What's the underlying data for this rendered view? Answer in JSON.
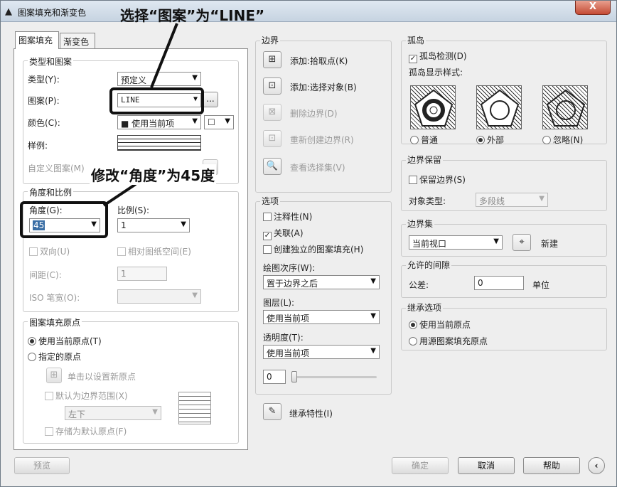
{
  "window": {
    "title": "图案填充和渐变色",
    "close_label": "X"
  },
  "annotations": {
    "top": "选择“图案”为“LINE”",
    "middle": "修改“角度”为45度"
  },
  "tabs": [
    {
      "label": "图案填充"
    },
    {
      "label": "渐变色"
    }
  ],
  "type_pattern": {
    "group_label": "类型和图案",
    "type_label": "类型(Y):",
    "type_value": "预定义",
    "pattern_label": "图案(P):",
    "pattern_value": "LINE",
    "pattern_browse": "...",
    "color_label": "颜色(C):",
    "color_value": "■ 使用当前项",
    "color_bg_value": "☐",
    "sample_label": "样例:",
    "custom_label": "自定义图案(M)"
  },
  "angle_scale": {
    "group_label": "角度和比例",
    "angle_label": "角度(G):",
    "angle_value": "45",
    "scale_label": "比例(S):",
    "scale_value": "1",
    "double_label": "双向(U)",
    "relative_label": "相对图纸空间(E)",
    "spacing_label": "间距(C):",
    "spacing_value": "1",
    "iso_label": "ISO 笔宽(O):"
  },
  "origin": {
    "group_label": "图案填充原点",
    "use_current": "使用当前原点(T)",
    "specified": "指定的原点",
    "click_set": "单击以设置新原点",
    "default_extent": "默认为边界范围(X)",
    "extent_value": "左下",
    "store_default": "存储为默认原点(F)"
  },
  "boundary": {
    "group_label": "边界",
    "add_pick": "添加:拾取点(K)",
    "add_select": "添加:选择对象(B)",
    "remove": "删除边界(D)",
    "recreate": "重新创建边界(R)",
    "view_selection": "查看选择集(V)"
  },
  "options": {
    "group_label": "选项",
    "annotative": "注释性(N)",
    "associative": "关联(A)",
    "separate": "创建独立的图案填充(H)",
    "draw_order_label": "绘图次序(W):",
    "draw_order_value": "置于边界之后",
    "layer_label": "图层(L):",
    "layer_value": "使用当前项",
    "transparency_label": "透明度(T):",
    "transparency_value": "使用当前项",
    "transparency_number": "0",
    "transparency_level": 0
  },
  "inherit": {
    "label": "继承特性(I)"
  },
  "islands": {
    "group_label": "孤岛",
    "detect": "孤岛检测(D)",
    "style_label": "孤岛显示样式:",
    "normal": "普通",
    "outer": "外部",
    "ignore": "忽略(N)"
  },
  "retention": {
    "group_label": "边界保留",
    "retain": "保留边界(S)",
    "object_type_label": "对象类型:",
    "object_type_value": "多段线"
  },
  "boundary_set": {
    "group_label": "边界集",
    "value": "当前视口",
    "new_label": "新建"
  },
  "gap": {
    "group_label": "允许的间隙",
    "tolerance_label": "公差:",
    "tolerance_value": "0",
    "unit_label": "单位"
  },
  "inherit_options": {
    "group_label": "继承选项",
    "use_current": "使用当前原点",
    "use_source": "用源图案填充原点"
  },
  "footer": {
    "preview": "预览",
    "ok": "确定",
    "cancel": "取消",
    "help": "帮助",
    "more": "‹"
  }
}
